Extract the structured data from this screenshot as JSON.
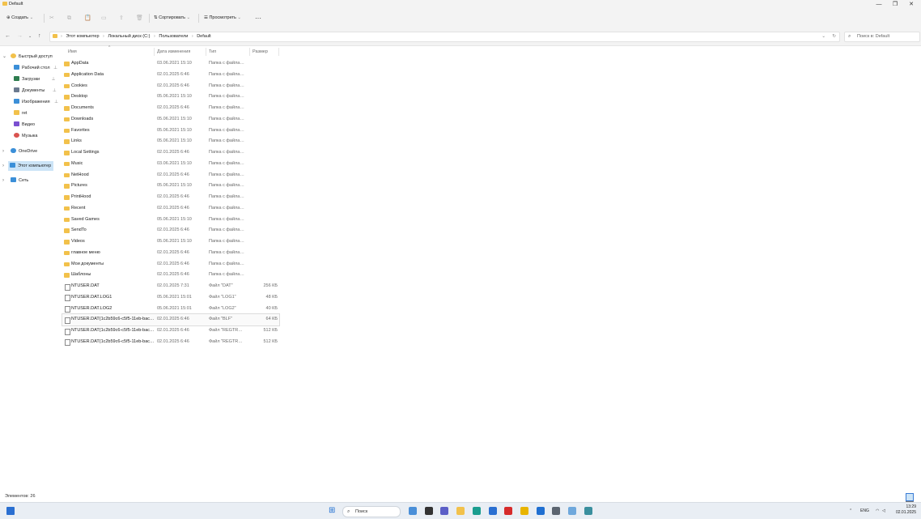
{
  "window": {
    "title": "Default",
    "minimize": "—",
    "maximize": "❐",
    "close": "✕"
  },
  "toolbar": {
    "new_label": "Создать",
    "sort_label": "Сортировать",
    "view_label": "Просмотреть",
    "more_label": "···"
  },
  "address": {
    "crumbs": [
      "Этот компьютер",
      "Локальный диск (C:)",
      "Пользователи",
      "Default"
    ],
    "search_placeholder": "Поиск в: Default"
  },
  "sidebar": {
    "items": [
      {
        "label": "Быстрый доступ",
        "icon": "star-icon",
        "color": "#f2c14b",
        "pinned": false,
        "expandable": true
      },
      {
        "label": "Рабочий стол",
        "icon": "desktop-icon",
        "color": "#3b8fd8",
        "pinned": true
      },
      {
        "label": "Загрузки",
        "icon": "download-icon",
        "color": "#2e7d4f",
        "pinned": true
      },
      {
        "label": "Документы",
        "icon": "documents-icon",
        "color": "#6b7a8f",
        "pinned": true
      },
      {
        "label": "Изображения",
        "icon": "pictures-icon",
        "color": "#3b8fd8",
        "pinned": true
      },
      {
        "label": "ret",
        "icon": "folder-icon",
        "color": "#f2c14b",
        "pinned": false
      },
      {
        "label": "Видео",
        "icon": "video-icon",
        "color": "#7a4fd0",
        "pinned": false
      },
      {
        "label": "Музыка",
        "icon": "music-icon",
        "color": "#d9534f",
        "pinned": false
      },
      {
        "label": "OneDrive",
        "icon": "cloud-icon",
        "color": "#3b8fd8",
        "pinned": false,
        "expandable": true
      },
      {
        "label": "Этот компьютер",
        "icon": "computer-icon",
        "color": "#3b8fd8",
        "pinned": false,
        "expandable": true,
        "selected": true
      },
      {
        "label": "Сеть",
        "icon": "network-icon",
        "color": "#3b8fd8",
        "pinned": false,
        "expandable": true
      }
    ]
  },
  "columns": {
    "name": "Имя",
    "date": "Дата изменения",
    "type": "Тип",
    "size": "Размер"
  },
  "files": [
    {
      "name": "AppData",
      "date": "03.06.2021 15:10",
      "type": "Папка с файлами",
      "size": "",
      "kind": "folder"
    },
    {
      "name": "Application Data",
      "date": "02.01.2025 6:46",
      "type": "Папка с файлами",
      "size": "",
      "kind": "folder"
    },
    {
      "name": "Cookies",
      "date": "02.01.2025 6:46",
      "type": "Папка с файлами",
      "size": "",
      "kind": "folder"
    },
    {
      "name": "Desktop",
      "date": "05.06.2021 15:10",
      "type": "Папка с файлами",
      "size": "",
      "kind": "folder"
    },
    {
      "name": "Documents",
      "date": "02.01.2025 6:46",
      "type": "Папка с файлами",
      "size": "",
      "kind": "folder"
    },
    {
      "name": "Downloads",
      "date": "05.06.2021 15:10",
      "type": "Папка с файлами",
      "size": "",
      "kind": "folder"
    },
    {
      "name": "Favorites",
      "date": "05.06.2021 15:10",
      "type": "Папка с файлами",
      "size": "",
      "kind": "folder"
    },
    {
      "name": "Links",
      "date": "05.06.2021 15:10",
      "type": "Папка с файлами",
      "size": "",
      "kind": "folder"
    },
    {
      "name": "Local Settings",
      "date": "02.01.2025 6:46",
      "type": "Папка с файлами",
      "size": "",
      "kind": "folder"
    },
    {
      "name": "Music",
      "date": "03.06.2021 15:10",
      "type": "Папка с файлами",
      "size": "",
      "kind": "folder"
    },
    {
      "name": "NetHood",
      "date": "02.01.2025 6:46",
      "type": "Папка с файлами",
      "size": "",
      "kind": "folder"
    },
    {
      "name": "Pictures",
      "date": "05.06.2021 15:10",
      "type": "Папка с файлами",
      "size": "",
      "kind": "folder"
    },
    {
      "name": "PrintHood",
      "date": "02.01.2025 6:46",
      "type": "Папка с файлами",
      "size": "",
      "kind": "folder"
    },
    {
      "name": "Recent",
      "date": "02.01.2025 6:46",
      "type": "Папка с файлами",
      "size": "",
      "kind": "folder"
    },
    {
      "name": "Saved Games",
      "date": "05.06.2021 15:10",
      "type": "Папка с файлами",
      "size": "",
      "kind": "folder"
    },
    {
      "name": "SendTo",
      "date": "02.01.2025 6:46",
      "type": "Папка с файлами",
      "size": "",
      "kind": "folder"
    },
    {
      "name": "Videos",
      "date": "05.06.2021 15:10",
      "type": "Папка с файлами",
      "size": "",
      "kind": "folder"
    },
    {
      "name": "главное меню",
      "date": "02.01.2025 6:46",
      "type": "Папка с файлами",
      "size": "",
      "kind": "folder"
    },
    {
      "name": "Мои документы",
      "date": "02.01.2025 6:46",
      "type": "Папка с файлами",
      "size": "",
      "kind": "folder"
    },
    {
      "name": "Шаблоны",
      "date": "02.01.2025 6:46",
      "type": "Папка с файлами",
      "size": "",
      "kind": "folder"
    },
    {
      "name": "NTUSER.DAT",
      "date": "02.01.2025 7:31",
      "type": "Файл \"DAT\"",
      "size": "256 КБ",
      "kind": "file"
    },
    {
      "name": "NTUSER.DAT.LOG1",
      "date": "05.06.2021 15:01",
      "type": "Файл \"LOG1\"",
      "size": "48 КБ",
      "kind": "file"
    },
    {
      "name": "NTUSER.DAT.LOG2",
      "date": "05.06.2021 15:01",
      "type": "Файл \"LOG2\"",
      "size": "40 КБ",
      "kind": "file"
    },
    {
      "name": "NTUSER.DAT{1c2b59c6-c5f5-11eb-bacb-...",
      "date": "02.01.2025 6:46",
      "type": "Файл \"BLF\"",
      "size": "64 КБ",
      "kind": "file",
      "selected": true
    },
    {
      "name": "NTUSER.DAT{1c2b59c6-c5f5-11eb-bacb-...",
      "date": "02.01.2025 6:46",
      "type": "Файл \"REGTRANS-MS\"",
      "size": "512 КБ",
      "kind": "file"
    },
    {
      "name": "NTUSER.DAT{1c2b59c6-c5f5-11eb-bacb-...",
      "date": "02.01.2025 6:46",
      "type": "Файл \"REGTRANS-MS\"",
      "size": "512 КБ",
      "kind": "file"
    }
  ],
  "status": {
    "count_text": "Элементов: 26"
  },
  "taskbar": {
    "search_label": "Поиск",
    "lang": "ENG",
    "time": "13:29",
    "date": "02.01.2025",
    "icons": [
      {
        "name": "widgets-icon",
        "color": "#4a8fd8"
      },
      {
        "name": "task-view-icon",
        "color": "#333333"
      },
      {
        "name": "chat-icon",
        "color": "#5b5fc7"
      },
      {
        "name": "file-explorer-icon",
        "color": "#f2c14b"
      },
      {
        "name": "edge-icon",
        "color": "#1a9d8f"
      },
      {
        "name": "store-icon",
        "color": "#2a6fd1"
      },
      {
        "name": "opera-icon",
        "color": "#d62b2b"
      },
      {
        "name": "yandex-icon",
        "color": "#e8b400"
      },
      {
        "name": "defender-icon",
        "color": "#1f6fd1"
      },
      {
        "name": "settings-icon",
        "color": "#5b6470"
      },
      {
        "name": "photos-icon",
        "color": "#6fa8dc"
      },
      {
        "name": "globe-icon",
        "color": "#3a8f9e"
      }
    ]
  }
}
